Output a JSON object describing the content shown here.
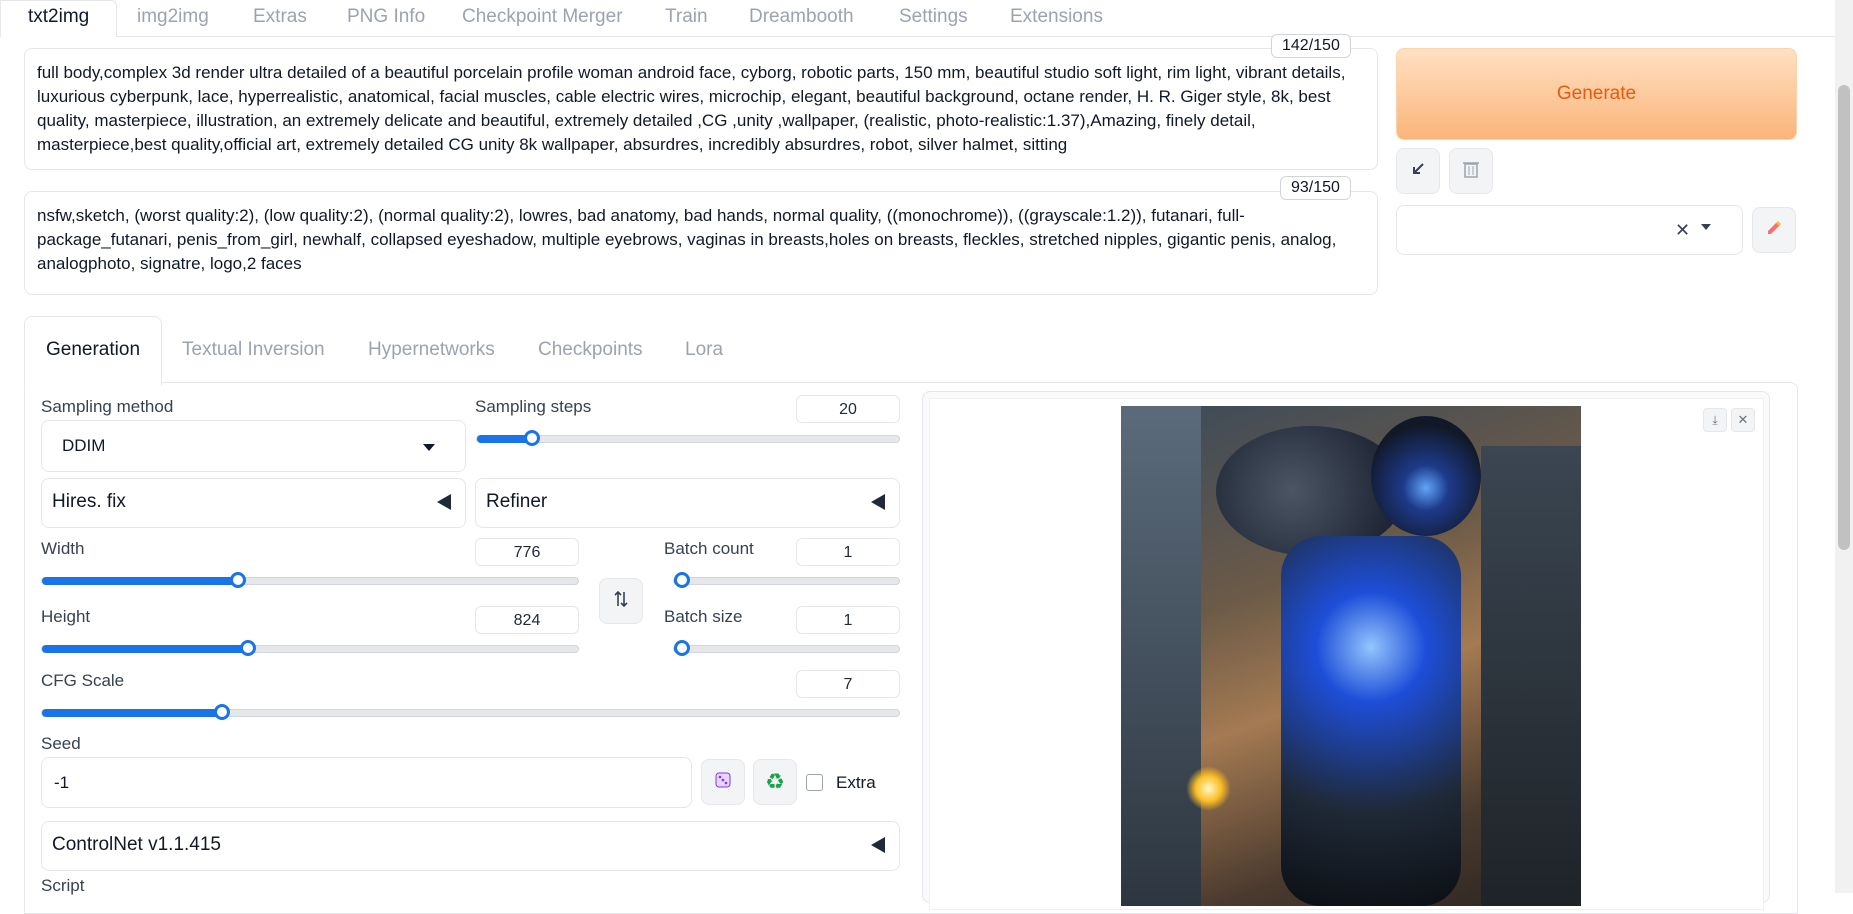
{
  "top_tabs": [
    "txt2img",
    "img2img",
    "Extras",
    "PNG Info",
    "Checkpoint Merger",
    "Train",
    "Dreambooth",
    "Settings",
    "Extensions"
  ],
  "prompt": {
    "counter": "142/150",
    "text": "full body,complex 3d render ultra detailed of a beautiful porcelain profile woman android face, cyborg, robotic parts, 150 mm, beautiful studio soft light, rim light, vibrant details, luxurious cyberpunk, lace, hyperrealistic, anatomical, facial muscles, cable electric wires, microchip, elegant, beautiful background, octane render, H. R. Giger style, 8k, best quality, masterpiece, illustration, an extremely delicate and beautiful, extremely detailed ,CG ,unity ,wallpaper, (realistic, photo-realistic:1.37),Amazing, finely detail, masterpiece,best quality,official art, extremely detailed CG unity 8k wallpaper, absurdres, incredibly absurdres, robot, silver halmet, sitting"
  },
  "negative_prompt": {
    "counter": "93/150",
    "text": " nsfw,sketch, (worst quality:2), (low quality:2), (normal quality:2), lowres, bad anatomy, bad hands, normal quality, ((monochrome)), ((grayscale:1.2)), futanari, full-package_futanari, penis_from_girl, newhalf, collapsed eyeshadow, multiple eyebrows, vaginas in breasts,holes on breasts, fleckles, stretched nipples, gigantic penis, analog, analogphoto, signatre, logo,2 faces"
  },
  "generate_label": "Generate",
  "sub_tabs": [
    "Generation",
    "Textual Inversion",
    "Hypernetworks",
    "Checkpoints",
    "Lora"
  ],
  "sampling_method": {
    "label": "Sampling method",
    "value": "DDIM"
  },
  "sampling_steps": {
    "label": "Sampling steps",
    "value": "20",
    "fraction": 0.13
  },
  "hires_fix": "Hires. fix",
  "refiner": "Refiner",
  "width": {
    "label": "Width",
    "value": "776",
    "fraction": 0.365
  },
  "height": {
    "label": "Height",
    "value": "824",
    "fraction": 0.385
  },
  "batch_count": {
    "label": "Batch count",
    "value": "1",
    "fraction": 0.0
  },
  "batch_size": {
    "label": "Batch size",
    "value": "1",
    "fraction": 0.0
  },
  "cfg_scale": {
    "label": "CFG Scale",
    "value": "7",
    "fraction": 0.21
  },
  "seed": {
    "label": "Seed",
    "value": "-1"
  },
  "extra_label": "Extra",
  "controlnet": "ControlNet v1.1.415",
  "script_label": "Script",
  "colors": {
    "accent": "#1a73e8",
    "generate_text": "#ea580c"
  },
  "icons": [
    "paste-arrow-icon",
    "trash-icon",
    "clear-x-icon",
    "chevron-down-icon",
    "pencil-icon",
    "swap-icon",
    "dice-icon",
    "recycle-icon",
    "download-icon",
    "close-icon"
  ]
}
